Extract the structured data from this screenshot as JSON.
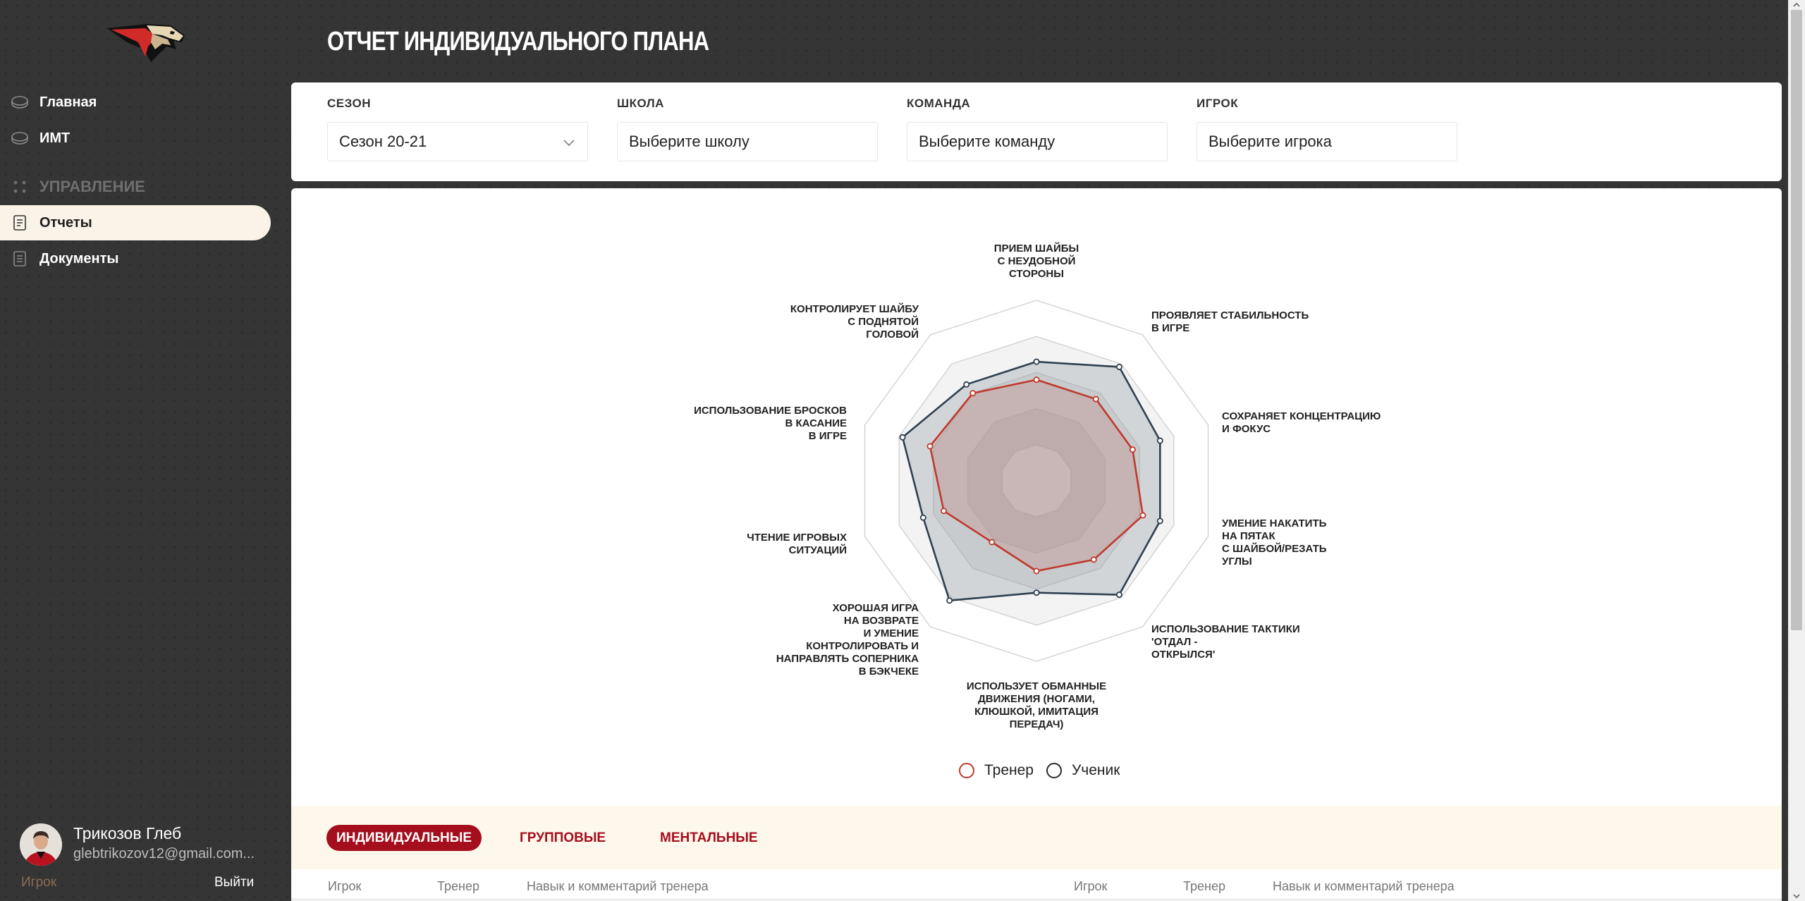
{
  "sidebar": {
    "nav": [
      {
        "label": "Главная",
        "icon": "puck-icon"
      },
      {
        "label": "ИМТ",
        "icon": "puck-icon"
      }
    ],
    "section": {
      "label": "УПРАВЛЕНИЕ",
      "icon": "grid-dots-icon"
    },
    "sub": [
      {
        "label": "Отчеты",
        "icon": "report-icon",
        "active": true
      },
      {
        "label": "Документы",
        "icon": "document-icon"
      }
    ]
  },
  "header": {
    "title": "Отчет индивидуального плана"
  },
  "filters": [
    {
      "label": "СЕЗОН",
      "value": "Сезон 20-21",
      "has_chevron": true
    },
    {
      "label": "ШКОЛА",
      "value": "Выберите школу"
    },
    {
      "label": "КОМАНДА",
      "value": "Выберите команду"
    },
    {
      "label": "ИГРОК",
      "value": "Выберите игрока"
    }
  ],
  "chart_data": {
    "type": "radar",
    "axes": [
      "Прием шайбы с неудобной стороны",
      "Проявляет стабильность в игре",
      "Сохраняет концентрацию и фокус",
      "Умение накатить на пятак с шайбой/резать углы",
      "Использование тактики 'отдал - открылся'",
      "Использует обманные движения (ногами, клюшкой, имитация передач)",
      "Хорошая игра на возврате и умение контролировать и направлять соперника в бэкчеке",
      "Чтение игровых ситуаций",
      "Использование бросков в касание в игре",
      "Контролирует шайбу с поднятой головой"
    ],
    "rmax": 5,
    "rings": [
      1,
      2,
      3,
      4,
      5
    ],
    "series": [
      {
        "name": "Ученик",
        "color": "#2f4050",
        "values": [
          3.3,
          3.9,
          3.6,
          3.6,
          3.9,
          3.1,
          4.1,
          3.3,
          3.9,
          3.3
        ]
      },
      {
        "name": "Тренер",
        "color": "#c0392b",
        "values": [
          2.8,
          2.8,
          2.8,
          3.1,
          2.7,
          2.5,
          2.1,
          2.7,
          3.1,
          3.0
        ]
      }
    ],
    "legend_position": "bottom"
  },
  "legend": [
    {
      "label": "Тренер",
      "color": "#c0392b"
    },
    {
      "label": "Ученик",
      "color": "#2f4050"
    }
  ],
  "tabs": [
    {
      "label": "Индивидуальные",
      "active": true
    },
    {
      "label": "Групповые"
    },
    {
      "label": "Ментальные"
    }
  ],
  "table_headers": {
    "left": [
      "Игрок",
      "Тренер",
      "Навык и комментарий тренера"
    ],
    "right": [
      "Игрок",
      "Тренер",
      "Навык и комментарий тренера"
    ]
  },
  "profile": {
    "name": "Трикозов Глеб",
    "email": "glebtrikozov12@gmail.com...",
    "role": "Игрок",
    "logout": "Выйти"
  }
}
